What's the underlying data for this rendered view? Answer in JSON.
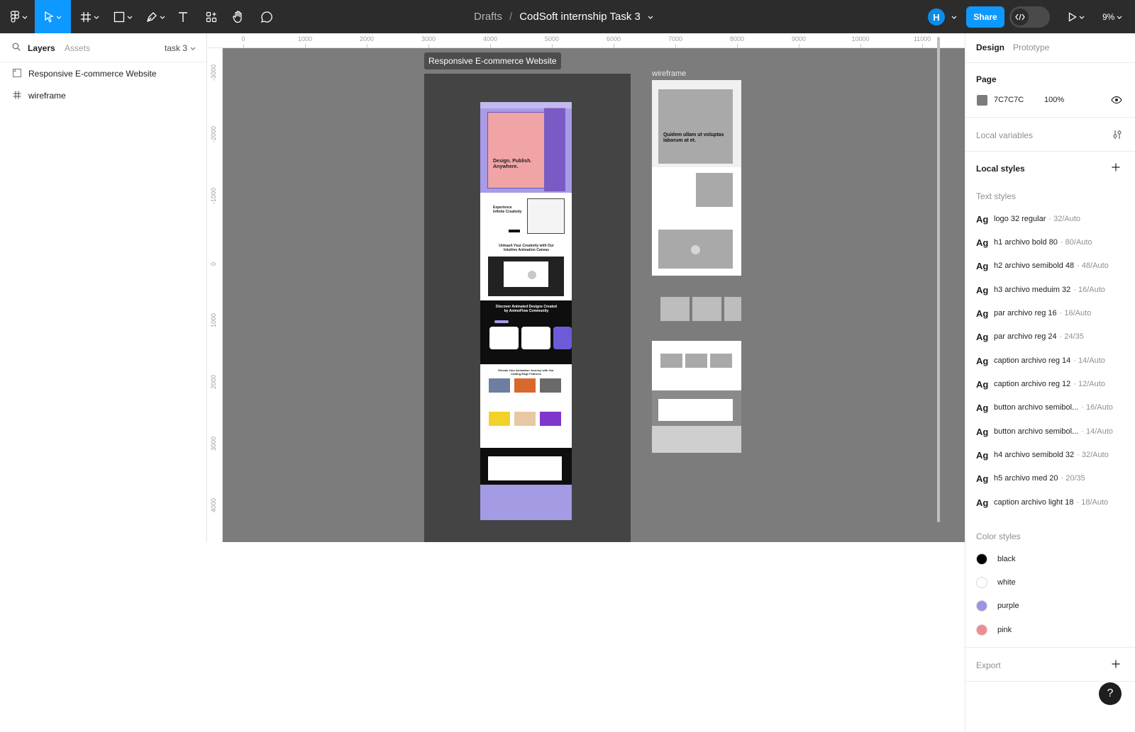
{
  "toolbar": {
    "breadcrumb_drafts": "Drafts",
    "breadcrumb_sep": "/",
    "file_name": "CodSoft internship Task 3",
    "avatar_initial": "H",
    "share_label": "Share",
    "zoom_label": "9%",
    "accent_color": "#0d99ff",
    "icons": [
      "figma-menu-icon",
      "move-tool-icon",
      "frame-tool-icon",
      "rectangle-tool-icon",
      "pen-tool-icon",
      "text-tool-icon",
      "components-icon",
      "hand-tool-icon",
      "comment-icon",
      "code-icon",
      "play-icon"
    ]
  },
  "left_panel": {
    "tab_layers": "Layers",
    "tab_assets": "Assets",
    "page_selector": "task 3",
    "layers": [
      {
        "name": "Responsive E-commerce Website",
        "icon": "frame-section-icon"
      },
      {
        "name": "wireframe",
        "icon": "frame-hash-icon"
      }
    ]
  },
  "canvas": {
    "background": "#7c7c7c",
    "ruler_top": [
      "0",
      "1000",
      "2000",
      "3000",
      "4000",
      "5000",
      "6000",
      "7000",
      "8000",
      "9000",
      "10000",
      "11000"
    ],
    "ruler_left": [
      "-3000",
      "-2000",
      "-1000",
      "0",
      "1000",
      "2000",
      "3000",
      "4000"
    ],
    "frame_tag": "Responsive E-commerce Website",
    "wireframe_label": "wireframe",
    "site": {
      "hero_title": "Design. Publish. Anywhere.",
      "creativity_title": "Experience Infinite Creativity",
      "canvas_title": "Unleash Your Creativity with Our Intuitive Animation Canvas",
      "discover_title": "Discover Animated Designs Created by AnimeFlow Community",
      "features_title": "Elevate Your Animation Journey with Our Cutting-Edge Features"
    },
    "wireframe": {
      "hero_title": "Quidem ullam ut voluptas laborum at et."
    }
  },
  "right_panel": {
    "tab_design": "Design",
    "tab_prototype": "Prototype",
    "page_heading": "Page",
    "page_color_hex": "7C7C7C",
    "page_opacity": "100%",
    "local_variables": "Local variables",
    "local_styles": "Local styles",
    "text_styles_heading": "Text styles",
    "text_styles": [
      {
        "name": "logo 32 regular",
        "spec": "· 32/Auto"
      },
      {
        "name": "h1 archivo bold 80",
        "spec": "· 80/Auto"
      },
      {
        "name": "h2 archivo semibold 48",
        "spec": "· 48/Auto"
      },
      {
        "name": "h3 archivo meduim 32",
        "spec": "· 16/Auto"
      },
      {
        "name": "par archivo reg 16",
        "spec": "· 16/Auto"
      },
      {
        "name": "par archivo reg 24",
        "spec": "· 24/35"
      },
      {
        "name": "caption archivo reg 14",
        "spec": "· 14/Auto"
      },
      {
        "name": "caption archivo reg 12",
        "spec": "· 12/Auto"
      },
      {
        "name": "button archivo semibol...",
        "spec": "· 16/Auto"
      },
      {
        "name": "button archivo semibol...",
        "spec": "· 14/Auto"
      },
      {
        "name": "h4 archivo semibold 32",
        "spec": "· 32/Auto"
      },
      {
        "name": "h5 archivo med 20",
        "spec": "· 20/35"
      },
      {
        "name": "caption archivo light 18",
        "spec": "· 18/Auto"
      }
    ],
    "color_styles_heading": "Color styles",
    "color_styles": [
      {
        "name": "black",
        "color": "#000000"
      },
      {
        "name": "white",
        "color": "#ffffff"
      },
      {
        "name": "purple",
        "color": "#9b94e4"
      },
      {
        "name": "pink",
        "color": "#f28b8f"
      }
    ],
    "export_label": "Export",
    "help_label": "?"
  }
}
